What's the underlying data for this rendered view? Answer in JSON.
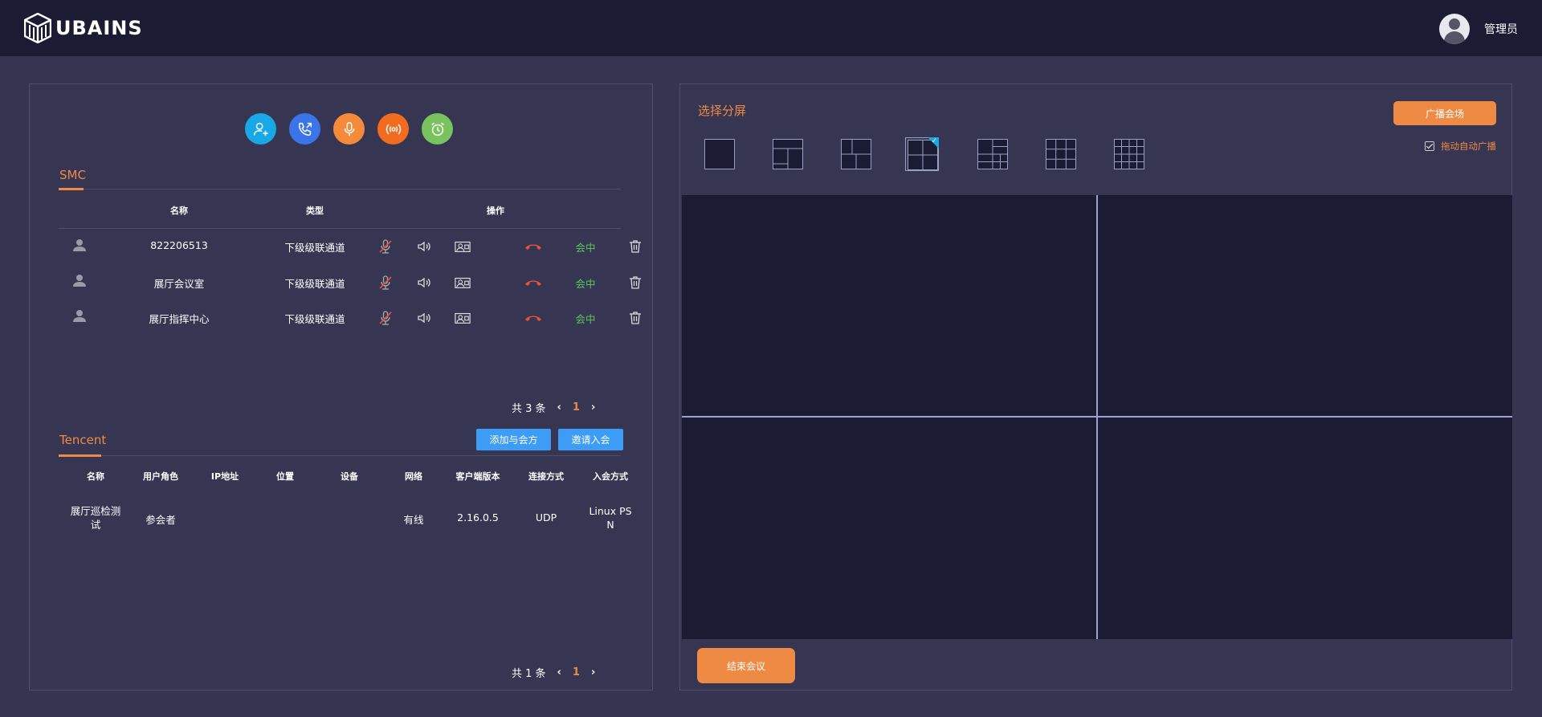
{
  "app": {
    "logo_text": "UBAINS",
    "user_name": "管理员"
  },
  "actions": [
    {
      "name": "add-participant",
      "icon": "user-add-icon",
      "color": "#18a8e6"
    },
    {
      "name": "call-transfer",
      "icon": "phone-transfer-icon",
      "color": "#3b74e9"
    },
    {
      "name": "microphone",
      "icon": "microphone-icon",
      "color": "#f58a3a"
    },
    {
      "name": "broadcast",
      "icon": "broadcast-icon",
      "color": "#f26b1f"
    },
    {
      "name": "alarm",
      "icon": "alarm-clock-icon",
      "color": "#79c35e"
    }
  ],
  "smc": {
    "title": "SMC",
    "headers": {
      "name": "名称",
      "type": "类型",
      "ops": "操作"
    },
    "rows": [
      {
        "name": "822206513",
        "type": "下级级联通道",
        "status": "会中"
      },
      {
        "name": "展厅会议室",
        "type": "下级级联通道",
        "status": "会中"
      },
      {
        "name": "展厅指挥中心",
        "type": "下级级联通道",
        "status": "会中"
      }
    ],
    "pager": {
      "total": "共 3 条",
      "page": "1"
    }
  },
  "tencent": {
    "title": "Tencent",
    "add_btn": "添加与会方",
    "invite_btn": "邀请入会",
    "headers": [
      "名称",
      "用户角色",
      "IP地址",
      "位置",
      "设备",
      "网络",
      "客户端版本",
      "连接方式",
      "入会方式"
    ],
    "rows": [
      {
        "name_l1": "展厅巡检测",
        "name_l2": "试",
        "role": "参会者",
        "ip": "",
        "location": "",
        "device": "",
        "network": "有线",
        "version": "2.16.0.5",
        "conn": "UDP",
        "join_l1": "Linux PS",
        "join_l2": "N"
      }
    ],
    "pager": {
      "total": "共 1 条",
      "page": "1"
    }
  },
  "split": {
    "title": "选择分屏",
    "broadcast_btn": "广播会场",
    "auto_broadcast": "拖动自动广播",
    "selected_layout": 4,
    "end_btn": "结束会议"
  },
  "colors": {
    "accent": "#ee8a44",
    "blue": "#3d9cf5",
    "in_meeting": "#5fc35f",
    "hangup": "#e8523a"
  }
}
